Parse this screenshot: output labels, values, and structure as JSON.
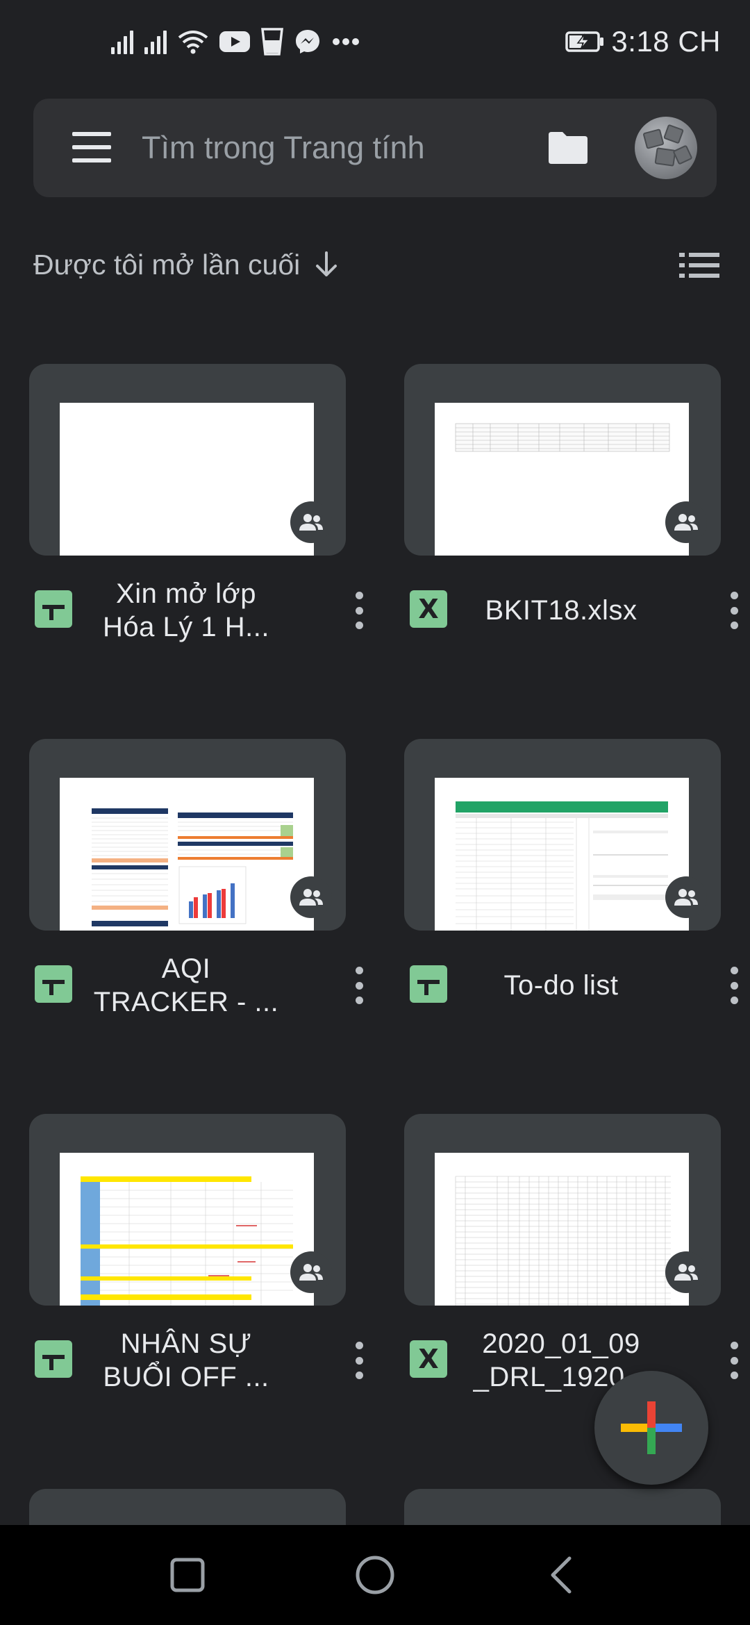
{
  "status_bar": {
    "time": "3:18 CH",
    "icons": [
      "signal-icon",
      "signal-icon",
      "wifi-icon",
      "youtube-icon",
      "drink-icon",
      "messenger-icon",
      "more-notifications-icon",
      "battery-charging-icon"
    ]
  },
  "search": {
    "placeholder": "Tìm trong Trang tính"
  },
  "sort": {
    "label": "Được tôi mở lần cuối",
    "direction_icon": "arrow-down-icon",
    "view_icon": "list-view-icon"
  },
  "files": [
    {
      "name_line1": "Xin mở lớp",
      "name_line2": "Hóa Lý 1 H...",
      "type": "google-sheets",
      "shared": true
    },
    {
      "name_line1": "BKIT18.xlsx",
      "name_line2": "",
      "type": "excel",
      "shared": true
    },
    {
      "name_line1": "AQI",
      "name_line2": "TRACKER - ...",
      "type": "google-sheets",
      "shared": true
    },
    {
      "name_line1": "To-do list",
      "name_line2": "",
      "type": "google-sheets",
      "shared": true
    },
    {
      "name_line1": "NHÂN SỰ",
      "name_line2": "BUỔI OFF ...",
      "type": "google-sheets",
      "shared": true
    },
    {
      "name_line1": "2020_01_09",
      "name_line2": "_DRL_1920...",
      "type": "excel",
      "shared": true
    }
  ],
  "type_labels": {
    "excel": "X"
  },
  "colors": {
    "background": "#202124",
    "surface": "#303134",
    "card": "#3c4043",
    "sheets_green": "#81c995",
    "fab_red": "#ea4335",
    "fab_yellow": "#fbbc04",
    "fab_green": "#34a853",
    "fab_blue": "#4285f4"
  }
}
